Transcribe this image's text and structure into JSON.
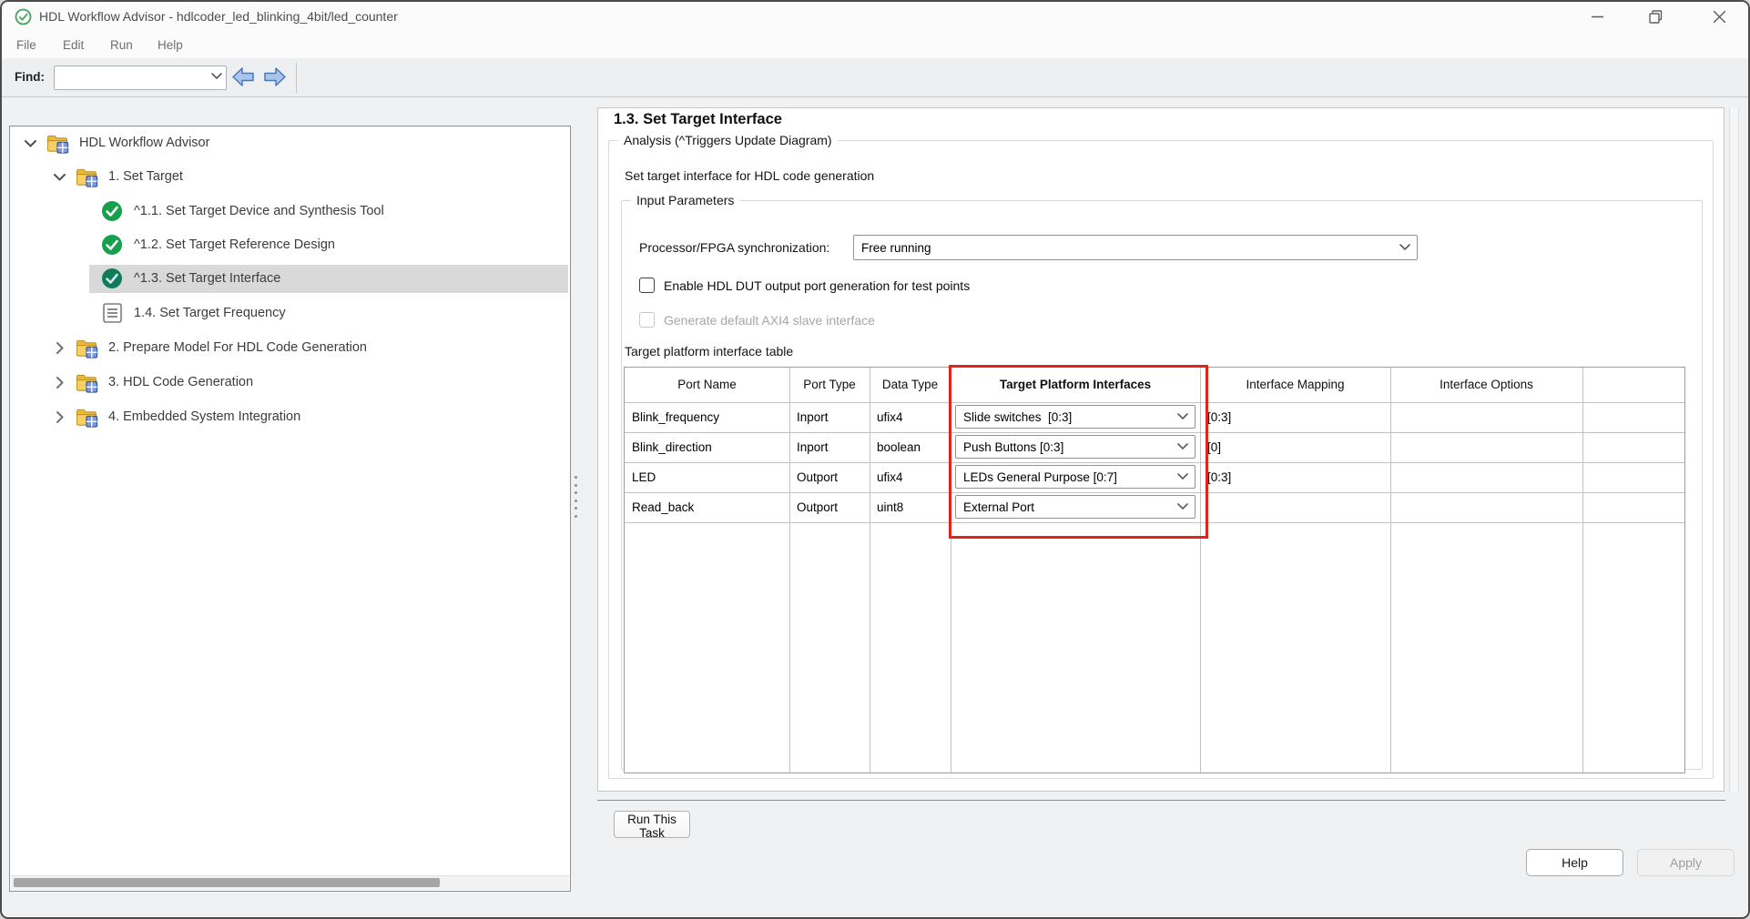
{
  "window": {
    "title": "HDL Workflow Advisor - hdlcoder_led_blinking_4bit/led_counter"
  },
  "menu": {
    "items": [
      {
        "label": "File"
      },
      {
        "label": "Edit"
      },
      {
        "label": "Run"
      },
      {
        "label": "Help"
      }
    ]
  },
  "find_bar": {
    "label": "Find:",
    "value": ""
  },
  "tree": {
    "items": [
      {
        "label": "HDL Workflow Advisor"
      },
      {
        "label": "1. Set Target"
      },
      {
        "label": "^1.1. Set Target Device and Synthesis Tool"
      },
      {
        "label": "^1.2. Set Target Reference Design"
      },
      {
        "label": "^1.3. Set Target Interface"
      },
      {
        "label": "1.4. Set Target Frequency"
      },
      {
        "label": "2. Prepare Model For HDL Code Generation"
      },
      {
        "label": "3. HDL Code Generation"
      },
      {
        "label": "4. Embedded System Integration"
      }
    ]
  },
  "task": {
    "title": "1.3. Set Target Interface",
    "analysis_group": "Analysis (^Triggers Update Diagram)",
    "description": "Set target interface for HDL code generation",
    "input_params_group": "Input Parameters",
    "sync_label": "Processor/FPGA synchronization:",
    "sync_value": "Free running",
    "checkbox_test_points": "Enable HDL DUT output port generation for test points",
    "checkbox_axi4": "Generate default AXI4 slave interface",
    "table_label": "Target platform interface table",
    "table": {
      "columns": [
        "Port Name",
        "Port Type",
        "Data Type",
        "Target Platform Interfaces",
        "Interface Mapping",
        "Interface Options"
      ],
      "rows": [
        {
          "port": "Blink_frequency",
          "type": "Inport",
          "dtype": "ufix4",
          "interface": "Slide switches  [0:3]",
          "mapping": "[0:3]",
          "options": ""
        },
        {
          "port": "Blink_direction",
          "type": "Inport",
          "dtype": "boolean",
          "interface": "Push Buttons [0:3]",
          "mapping": "[0]",
          "options": ""
        },
        {
          "port": "LED",
          "type": "Outport",
          "dtype": "ufix4",
          "interface": "LEDs General Purpose [0:7]",
          "mapping": "[0:3]",
          "options": ""
        },
        {
          "port": "Read_back",
          "type": "Outport",
          "dtype": "uint8",
          "interface": "External Port",
          "mapping": "",
          "options": ""
        }
      ]
    },
    "run_button": "Run This Task"
  },
  "footer": {
    "help": "Help",
    "apply": "Apply"
  },
  "colors": {
    "check_green": "#17a04b",
    "selected_check_green": "#0d7c57",
    "folder_yellow": "#f3c64a",
    "nav_arrow_blue": "#a9c5ec",
    "red_highlight": "#e2241b",
    "selection_gray": "#d9d9d9"
  }
}
